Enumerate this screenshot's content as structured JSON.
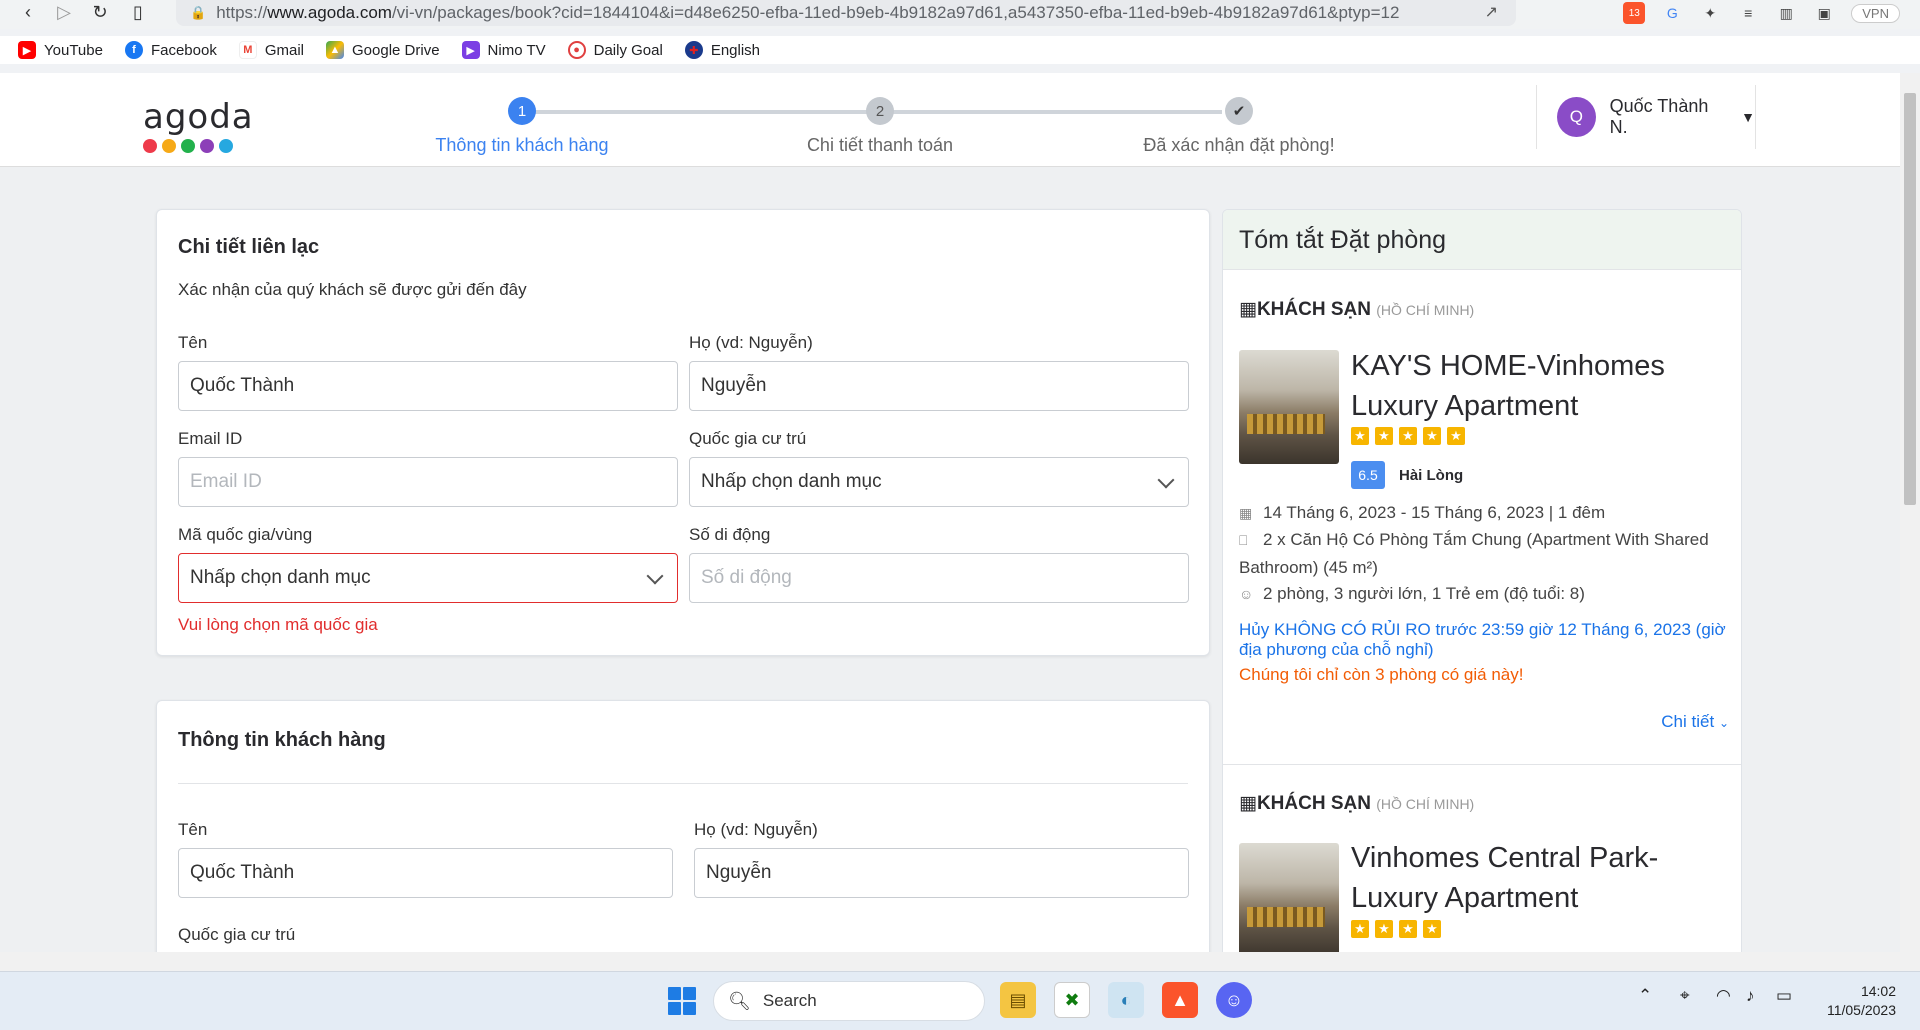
{
  "browser": {
    "url_proto": "https://",
    "url_domain": "www.agoda.com",
    "url_path": "/vi-vn/packages/book?cid=1844104&i=d48e6250-efba-11ed-b9eb-4b9182a97d61,a5437350-efba-11ed-b9eb-4b9182a97d61&ptyp=12",
    "vpn_label": "VPN",
    "brave_count": "13"
  },
  "bookmarks": [
    {
      "label": "YouTube",
      "color": "#ff0000",
      "icon": "youtube-icon"
    },
    {
      "label": "Facebook",
      "color": "#1877f2",
      "icon": "facebook-icon"
    },
    {
      "label": "Gmail",
      "color": "#ea4335",
      "icon": "gmail-icon"
    },
    {
      "label": "Google Drive",
      "color": "#34a853",
      "icon": "drive-icon"
    },
    {
      "label": "Nimo TV",
      "color": "#7b3fe4",
      "icon": "nimo-icon"
    },
    {
      "label": "Daily Goal",
      "color": "#e04040",
      "icon": "target-icon"
    },
    {
      "label": "English",
      "color": "#1a3a8c",
      "icon": "uk-flag-icon"
    }
  ],
  "header": {
    "logo": "agoda",
    "logo_colors": [
      "#ee3a4a",
      "#f6a917",
      "#22b14c",
      "#8c3fb8",
      "#26a8e0"
    ],
    "steps": [
      {
        "num": "1",
        "label": "Thông tin khách hàng",
        "state": "active"
      },
      {
        "num": "2",
        "label": "Chi tiết thanh toán",
        "state": "pending"
      },
      {
        "num": "✔",
        "label": "Đã xác nhận đặt phòng!",
        "state": "done"
      }
    ],
    "user_initial": "Q",
    "user_name": "Quốc Thành N."
  },
  "contact": {
    "title": "Chi tiết liên lạc",
    "subtitle": "Xác nhận của quý khách sẽ được gửi đến đây",
    "first_name_label": "Tên",
    "first_name_value": "Quốc Thành",
    "last_name_label": "Họ (vd: Nguyễn)",
    "last_name_value": "Nguyễn",
    "email_label": "Email ID",
    "email_placeholder": "Email ID",
    "country_label": "Quốc gia cư trú",
    "country_value": "Nhấp chọn danh mục",
    "code_label": "Mã quốc gia/vùng",
    "code_value": "Nhấp chọn danh mục",
    "phone_label": "Số di động",
    "phone_placeholder": "Số di động",
    "code_error": "Vui lòng chọn mã quốc gia"
  },
  "guest": {
    "title": "Thông tin khách hàng",
    "first_name_label": "Tên",
    "first_name_value": "Quốc Thành",
    "last_name_label": "Họ (vd: Nguyễn)",
    "last_name_value": "Nguyễn",
    "country_label": "Quốc gia cư trú"
  },
  "summary": {
    "title": "Tóm tắt Đặt phòng",
    "hotels": [
      {
        "type": "KHÁCH SẠN",
        "city": "(HỒ CHÍ MINH)",
        "name": "KAY'S HOME-Vinhomes Luxury Apartment",
        "stars": 5,
        "score": "6.5",
        "score_text": "Hài Lòng",
        "dates": "14 Tháng 6, 2023 - 15 Tháng 6, 2023 | 1 đêm",
        "room": "2 x Căn Hộ Có Phòng Tắm Chung (Apartment With Shared Bathroom) (45 m²)",
        "guests": "2 phòng, 3 người lớn, 1 Trẻ em (độ tuổi: 8)",
        "cancel": "Hủy KHÔNG CÓ RỦI RO trước 23:59 giờ 12 Tháng 6, 2023 (giờ địa phương của chỗ nghỉ)",
        "scarcity": "Chúng tôi chỉ còn 3 phòng có giá này!",
        "detail": "Chi tiết"
      },
      {
        "type": "KHÁCH SẠN",
        "city": "(HỒ CHÍ MINH)",
        "name": "Vinhomes Central Park-Luxury Apartment",
        "stars": 4
      }
    ]
  },
  "taskbar": {
    "search": "Search",
    "time": "14:02",
    "date": "11/05/2023"
  }
}
